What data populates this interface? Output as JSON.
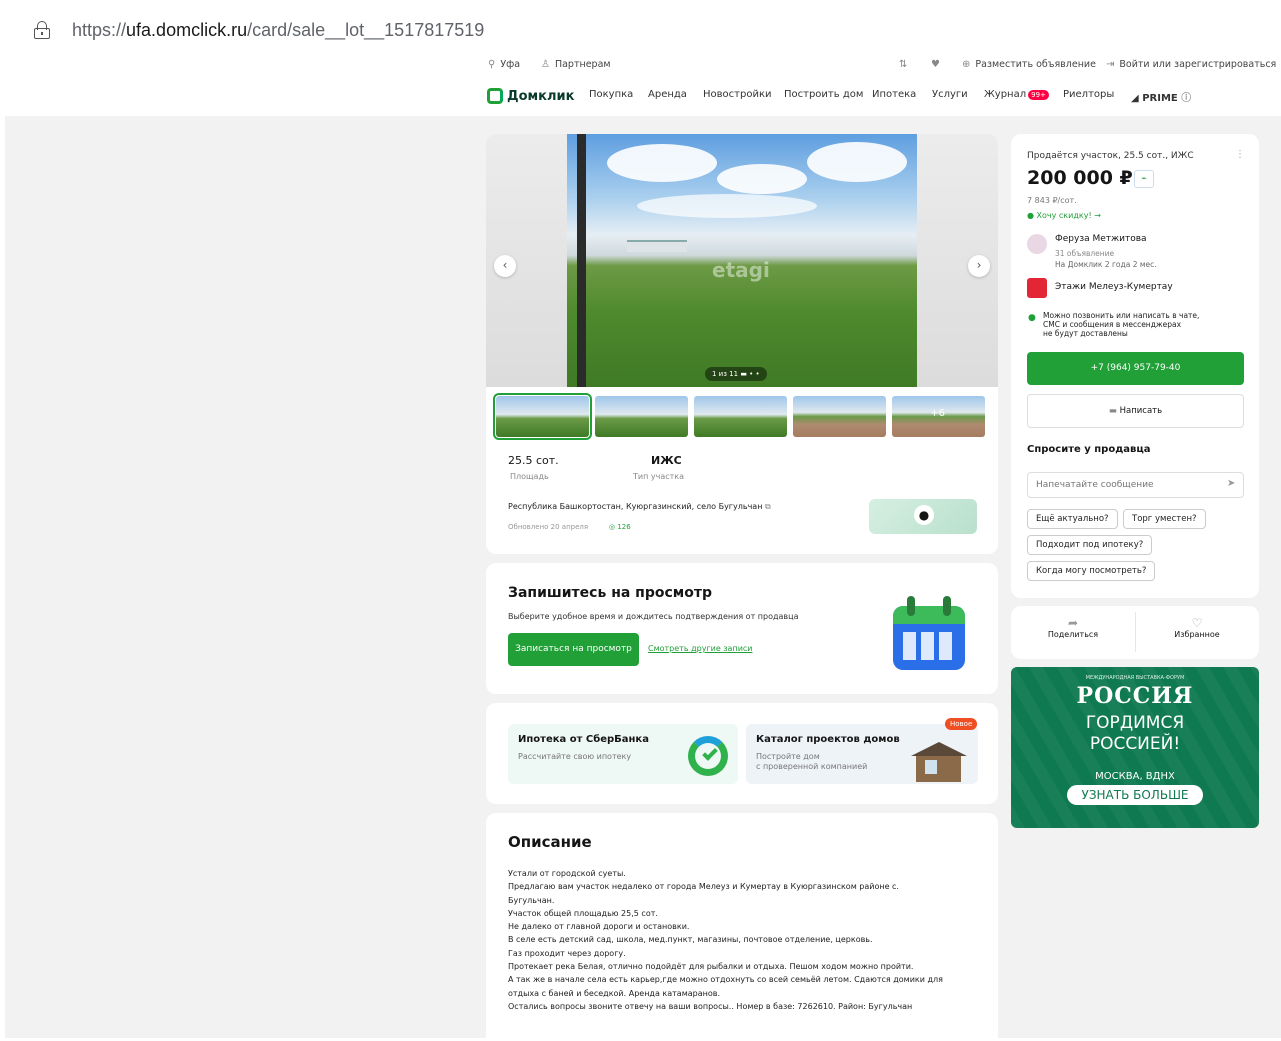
{
  "browser": {
    "url_prefix": "https://",
    "url_host": "ufa.domclick.ru",
    "url_path": "/card/sale__lot__1517817519"
  },
  "topbar": {
    "city": "Уфа",
    "partners": "Партнерам",
    "post_ad": "Разместить объявление",
    "login": "Войти или зарегистрироваться"
  },
  "nav": {
    "logo": "Домклик",
    "items": [
      "Покупка",
      "Аренда",
      "Новостройки",
      "Построить дом",
      "Ипотека",
      "Услуги",
      "Журнал",
      "Риелторы"
    ],
    "journal_badge": "99+",
    "prime": "PRIME"
  },
  "gallery": {
    "watermark": "etagi",
    "counter": "1 из 11",
    "more_photos": "+6"
  },
  "params": {
    "area_value": "25.5 сот.",
    "area_label": "Площадь",
    "type_value": "ИЖС",
    "type_label": "Тип участка"
  },
  "address": "Республика Башкортостан, Куюргазинский, село Бугульчан",
  "updated": "Обновлено 20 апреля",
  "views": "126",
  "viewing": {
    "title": "Запишитесь на просмотр",
    "subtitle": "Выберите удобное время и дождитесь подтверждения от продавца",
    "book_button": "Записаться на просмотр",
    "other_link": "Смотреть другие записи"
  },
  "promos": [
    {
      "title": "Ипотека от СберБанка",
      "subtitle": "Рассчитайте свою ипотеку"
    },
    {
      "title": "Каталог проектов домов",
      "subtitle": "Постройте дом\nс проверенной компанией",
      "badge": "Новое"
    }
  ],
  "description": {
    "title": "Описание",
    "lines": [
      "Устали от городской суеты.",
      "Предлагаю вам участок недалеко от города Мелеуз и Кумертау в Куюргазинском районе с.",
      "Бугульчан.",
      "Участок общей площадью 25,5 сот.",
      "Не далеко от главной дороги и остановки.",
      "В селе есть детский сад, школа, мед.пункт, магазины, почтовое отделение, церковь.",
      "Газ проходит через дорогу.",
      "Протекает река Белая, отлично подойдёт для рыбалки и отдыха. Пешом ходом можно пройти.",
      "А так же в начале села есть карьер,где можно отдохнуть со всей семьёй летом. Сдаются домики для",
      "отдыха с баней и беседкой. Аренда катамаранов.",
      "Остались вопросы звоните отвечу на ваши вопросы.. Номер в базе: 7262610. Район: Бугульчан"
    ]
  },
  "sidebar": {
    "heading": "Продаётся участок, 25.5 сот., ИЖС",
    "price": "200 000 ₽",
    "price_per": "7 843 ₽/сот.",
    "discount": "Хочу скидку! →",
    "agent_name": "Феруза Метжитова",
    "agent_ads": "31 объявление",
    "agent_since": "На Домклик 2 года 2 мес.",
    "agency": "Этажи Мелеуз-Кумертау",
    "notice": "Можно позвонить или написать в чате,\nСМС и сообщения в мессенджерах\nне будут доставлены",
    "phone": "+7 (964) 957-79-40",
    "write": "Написать",
    "ask_title": "Спросите у продавца",
    "ask_placeholder": "Напечатайте сообщение",
    "chips": [
      "Ещё актуально?",
      "Торг уместен?",
      "Подходит под ипотеку?",
      "Когда могу посмотреть?"
    ],
    "share": "Поделиться",
    "favorite": "Избранное"
  },
  "ad": {
    "top": "МЕЖДУНАРОДНАЯ ВЫСТАВКА-ФОРУМ",
    "brand": "РОССИЯ",
    "line1": "ГОРДИМСЯ",
    "line2": "РОССИЕЙ!",
    "place": "МОСКВА, ВДНХ",
    "cta": "УЗНАТЬ БОЛЬШЕ"
  },
  "colors": {
    "accent": "#21a038",
    "ad_bg": "#0f7a52"
  }
}
